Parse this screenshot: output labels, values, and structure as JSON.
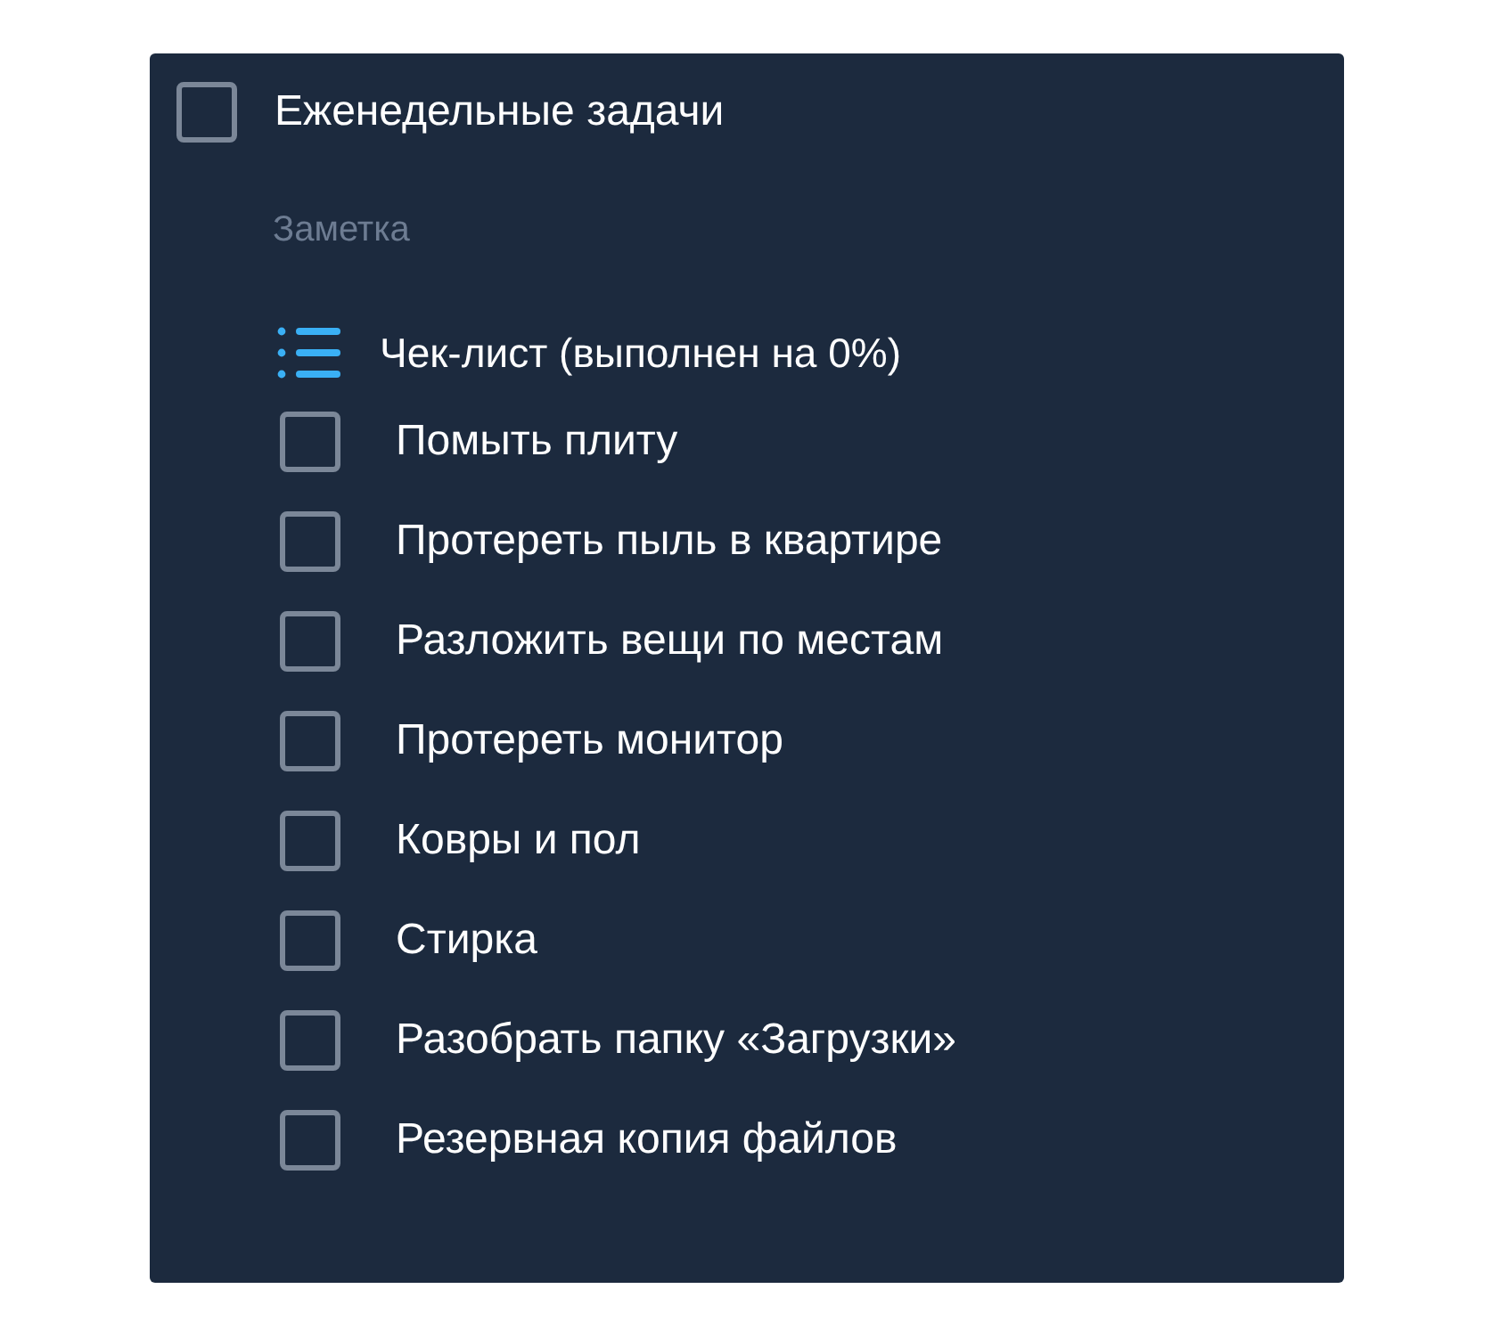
{
  "task": {
    "title": "Еженедельные задачи",
    "checked": false
  },
  "note": {
    "placeholder": "Заметка"
  },
  "checklist": {
    "title": "Чек-лист (выполнен на 0%)",
    "items": [
      {
        "label": "Помыть плиту",
        "checked": false
      },
      {
        "label": "Протереть пыль в квартире",
        "checked": false
      },
      {
        "label": "Разложить вещи по местам",
        "checked": false
      },
      {
        "label": "Протереть монитор",
        "checked": false
      },
      {
        "label": "Ковры и пол",
        "checked": false
      },
      {
        "label": "Стирка",
        "checked": false
      },
      {
        "label": "Разобрать папку «Загрузки»",
        "checked": false
      },
      {
        "label": "Резервная копия файлов",
        "checked": false
      }
    ]
  }
}
